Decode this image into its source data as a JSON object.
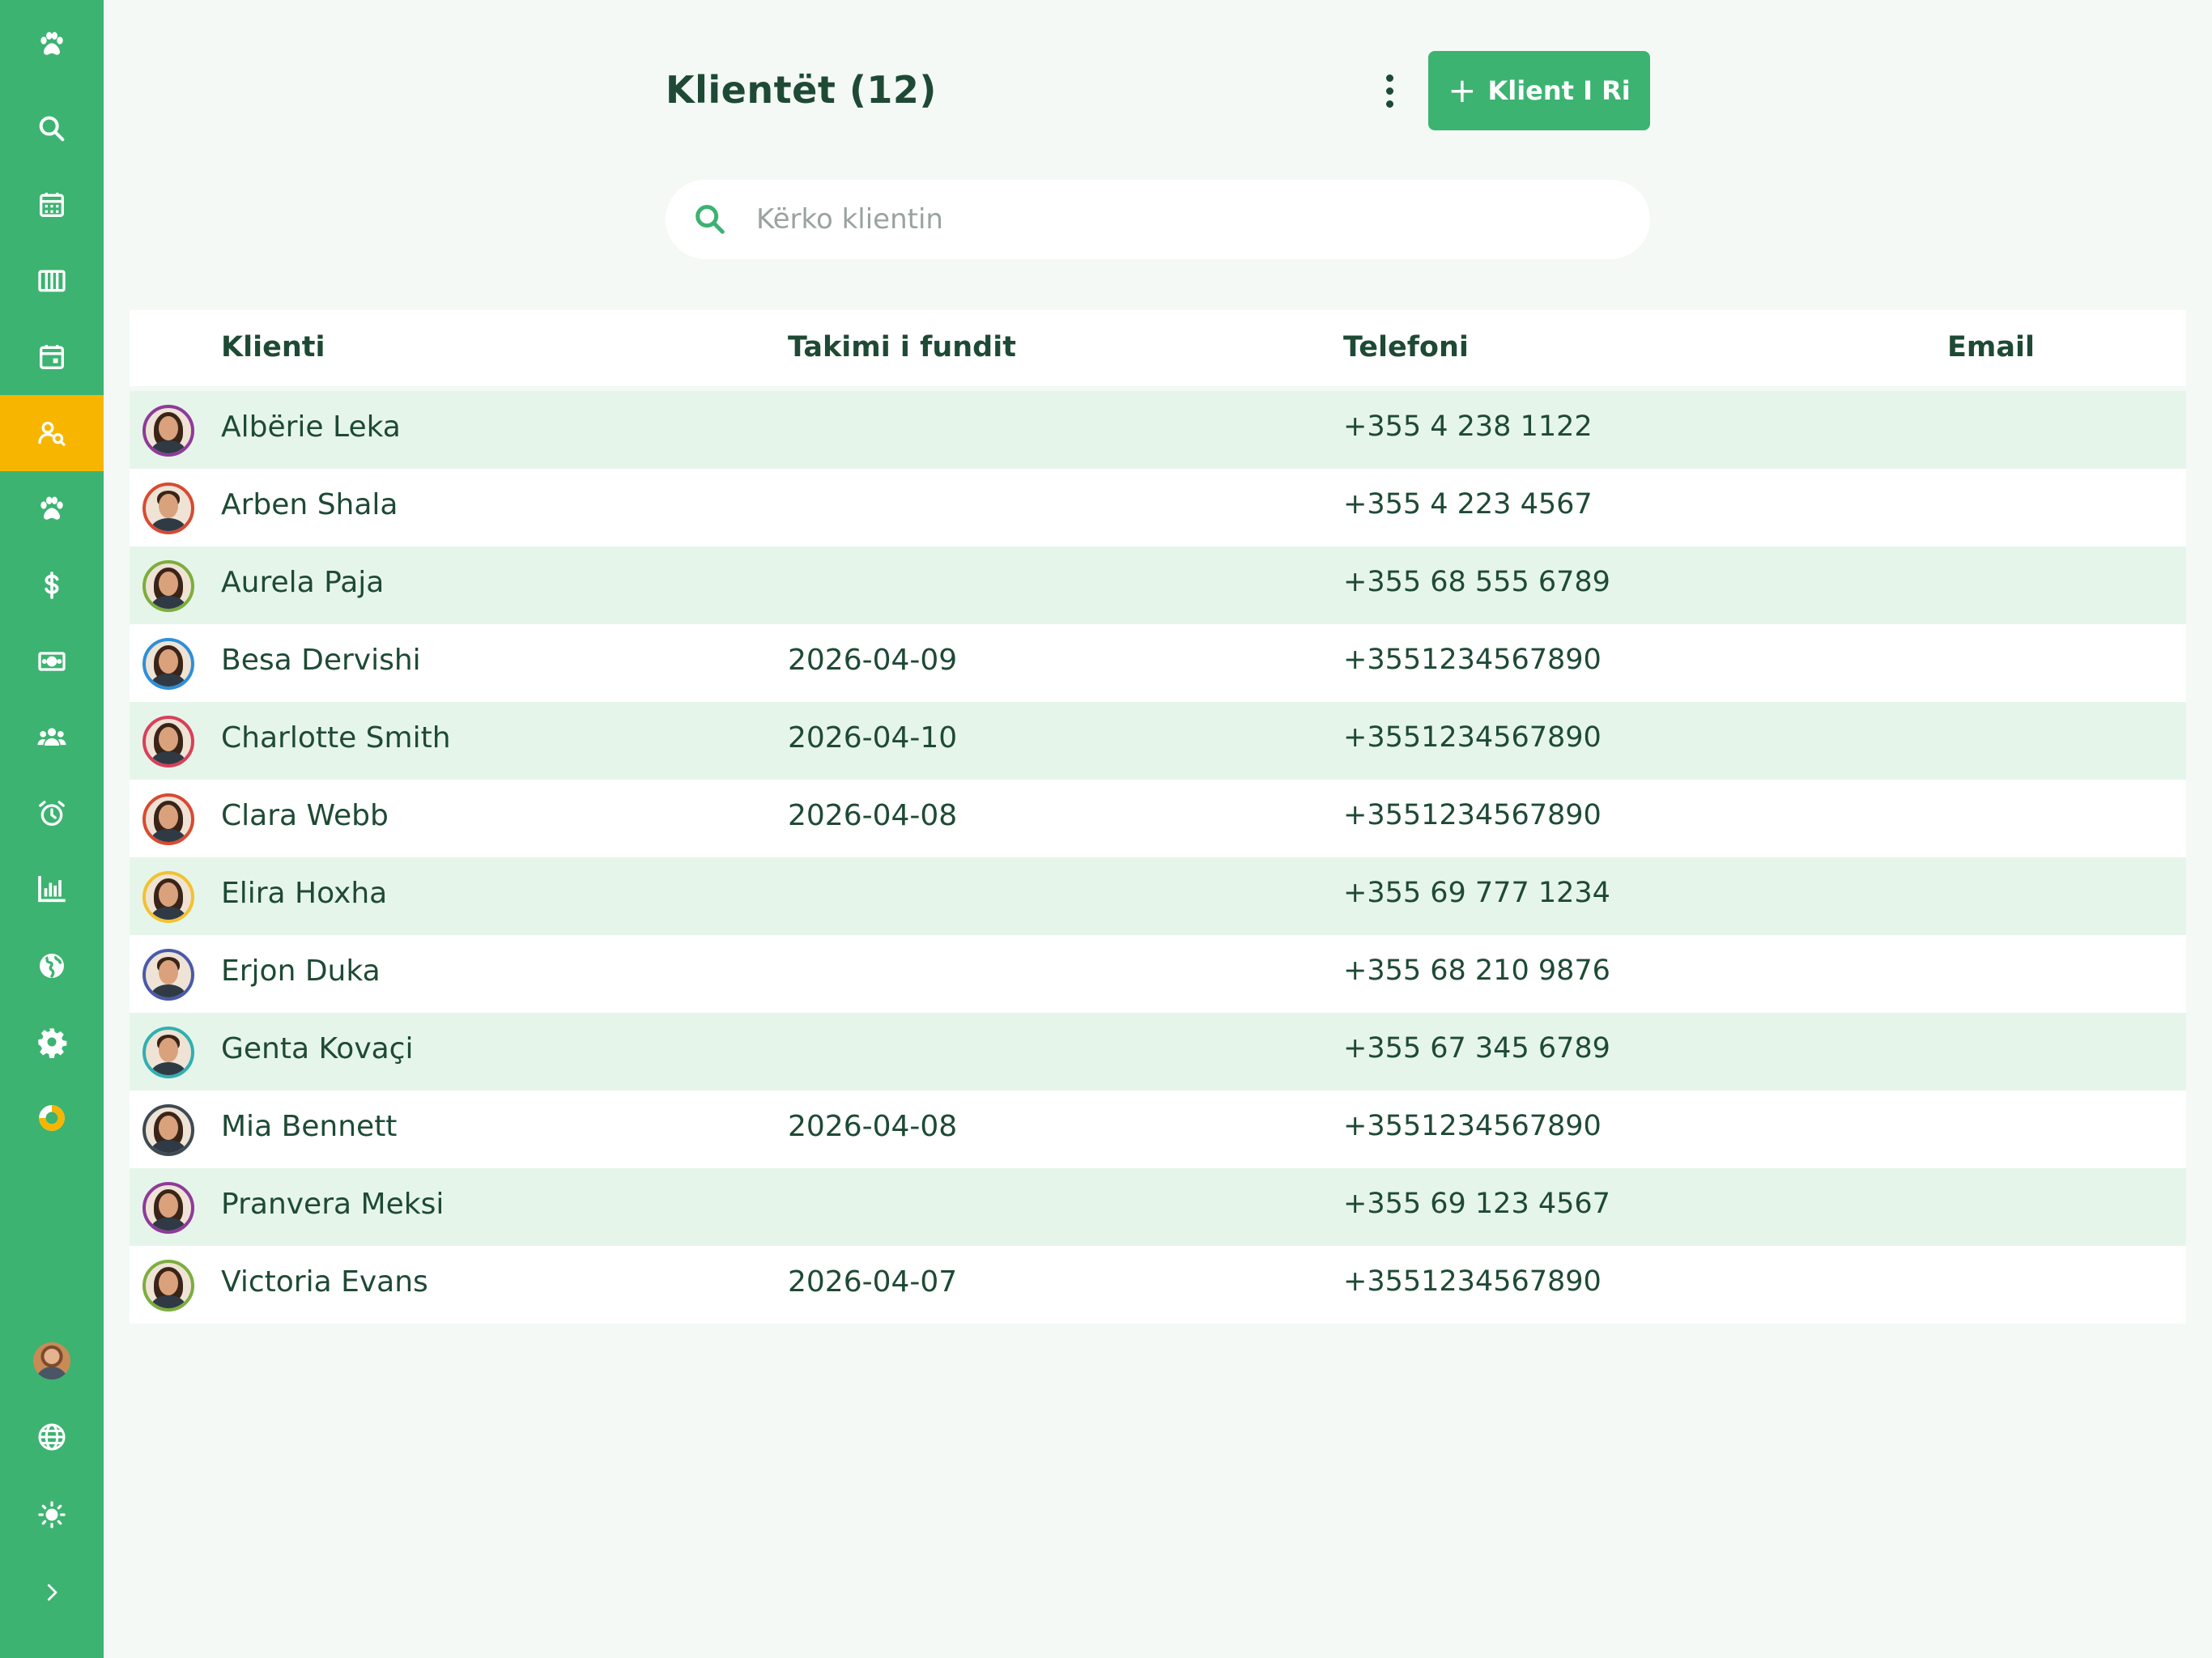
{
  "sidebar": {
    "items": [
      {
        "icon": "paw-logo-icon",
        "active": false
      },
      {
        "icon": "search-icon",
        "active": false
      },
      {
        "icon": "calendar-icon",
        "active": false
      },
      {
        "icon": "columns-icon",
        "active": false
      },
      {
        "icon": "calendar-event-icon",
        "active": false
      },
      {
        "icon": "client-search-icon",
        "active": true
      },
      {
        "icon": "paw-icon",
        "active": false
      },
      {
        "icon": "dollar-icon",
        "active": false
      },
      {
        "icon": "money-icon",
        "active": false
      },
      {
        "icon": "users-icon",
        "active": false
      },
      {
        "icon": "alarm-icon",
        "active": false
      },
      {
        "icon": "bar-chart-icon",
        "active": false
      },
      {
        "icon": "globe-filled-icon",
        "active": false
      },
      {
        "icon": "settings-icon",
        "active": false
      },
      {
        "icon": "donut-icon",
        "active": false
      }
    ],
    "bottom": [
      {
        "icon": "user-avatar"
      },
      {
        "icon": "language-icon"
      },
      {
        "icon": "theme-icon"
      },
      {
        "icon": "expand-icon"
      }
    ]
  },
  "header": {
    "title": "Klientët (12)",
    "add_button_label": "Klient I Ri"
  },
  "search": {
    "placeholder": "Kërko klientin",
    "value": ""
  },
  "table": {
    "columns": {
      "client": "Klienti",
      "last_appointment": "Takimi i fundit",
      "phone": "Telefoni",
      "email": "Email"
    },
    "rows": [
      {
        "name": "Albërie Leka",
        "last": "",
        "phone": "+355 4 238 1122",
        "email": "",
        "ring": "#8e3b9a",
        "gender": "f"
      },
      {
        "name": "Arben Shala",
        "last": "",
        "phone": "+355 4 223 4567",
        "email": "",
        "ring": "#d84a32",
        "gender": "m"
      },
      {
        "name": "Aurela Paja",
        "last": "",
        "phone": "+355 68 555 6789",
        "email": "",
        "ring": "#7cae3c",
        "gender": "f"
      },
      {
        "name": "Besa Dervishi",
        "last": "2026-04-09",
        "phone": "+3551234567890",
        "email": "",
        "ring": "#2f8fd8",
        "gender": "f"
      },
      {
        "name": "Charlotte Smith",
        "last": "2026-04-10",
        "phone": "+3551234567890",
        "email": "",
        "ring": "#d8405a",
        "gender": "f"
      },
      {
        "name": "Clara Webb",
        "last": "2026-04-08",
        "phone": "+3551234567890",
        "email": "",
        "ring": "#d84a32",
        "gender": "f"
      },
      {
        "name": "Elira Hoxha",
        "last": "",
        "phone": "+355 69 777 1234",
        "email": "",
        "ring": "#f2c230",
        "gender": "f"
      },
      {
        "name": "Erjon Duka",
        "last": "",
        "phone": "+355 68 210 9876",
        "email": "",
        "ring": "#4a5aa8",
        "gender": "m"
      },
      {
        "name": "Genta Kovaçi",
        "last": "",
        "phone": "+355 67 345 6789",
        "email": "",
        "ring": "#2fb0b0",
        "gender": "m"
      },
      {
        "name": "Mia Bennett",
        "last": "2026-04-08",
        "phone": "+3551234567890",
        "email": "",
        "ring": "#3f4a52",
        "gender": "f"
      },
      {
        "name": "Pranvera Meksi",
        "last": "",
        "phone": "+355 69 123 4567",
        "email": "",
        "ring": "#8e3b9a",
        "gender": "f"
      },
      {
        "name": "Victoria Evans",
        "last": "2026-04-07",
        "phone": "+3551234567890",
        "email": "",
        "ring": "#7cae3c",
        "gender": "f"
      }
    ]
  },
  "colors": {
    "primary": "#3cb371",
    "active": "#f7b500",
    "text": "#1e4a35",
    "row_alt": "#e6f5ea",
    "background": "#f4f9f5"
  }
}
